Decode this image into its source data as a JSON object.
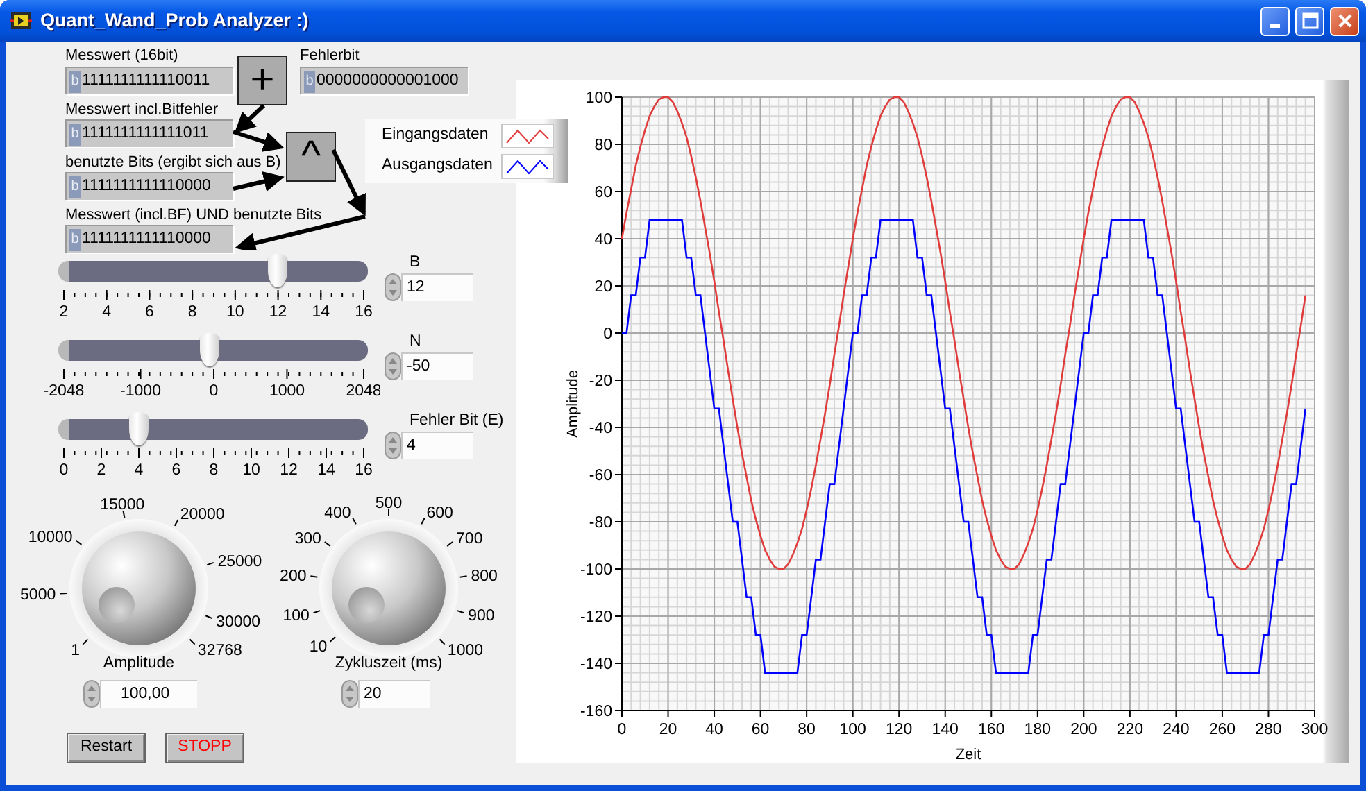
{
  "window": {
    "title": "Quant_Wand_Prob Analyzer :)"
  },
  "bit_indicators": [
    {
      "label": "Messwert (16bit)",
      "radix": "b",
      "value": "1111111111110011"
    },
    {
      "label": "Fehlerbit",
      "radix": "b",
      "value": "0000000000001000"
    },
    {
      "label": "Messwert incl.Bitfehler",
      "radix": "b",
      "value": "1111111111111011"
    },
    {
      "label": "benutzte Bits (ergibt sich aus B)",
      "radix": "b",
      "value": "1111111111110000"
    },
    {
      "label": "Messwert (incl.BF) UND benutzte Bits",
      "radix": "b",
      "value": "1111111111110000"
    }
  ],
  "operators": [
    "+",
    "^"
  ],
  "sliders": [
    {
      "label": "B",
      "level": 0.714,
      "ticks": [
        "2",
        "4",
        "6",
        "8",
        "10",
        "12",
        "14",
        "16"
      ],
      "value": "12"
    },
    {
      "label": "N",
      "level": 0.488,
      "ticks": [
        "-2048",
        "-1000",
        "0",
        "1000",
        "2048"
      ],
      "value": "-50"
    },
    {
      "label": "Fehler Bit (E)",
      "level": 0.25,
      "ticks": [
        "0",
        "2",
        "4",
        "6",
        "8",
        "10",
        "12",
        "14",
        "16"
      ],
      "value": "4"
    }
  ],
  "knobs": [
    {
      "label": "Amplitude",
      "ticks": [
        "1",
        "5000",
        "10000",
        "15000",
        "20000",
        "25000",
        "30000",
        "32768"
      ],
      "value": "100,00"
    },
    {
      "label": "Zykluszeit (ms)",
      "ticks": [
        "10",
        "100",
        "200",
        "300",
        "400",
        "500",
        "600",
        "700",
        "800",
        "900",
        "1000"
      ],
      "value": "20"
    }
  ],
  "buttons": [
    {
      "label": "Restart",
      "kind": "normal"
    },
    {
      "label": "STOPP",
      "kind": "stop"
    }
  ],
  "chart": {
    "chart_data": {
      "type": "line",
      "grid": true,
      "xlabel": "Zeit",
      "ylabel": "Amplitude",
      "xlim": [
        0,
        300
      ],
      "ylim": [
        -160,
        100
      ],
      "xticks": [
        0,
        20,
        40,
        60,
        80,
        100,
        120,
        140,
        160,
        180,
        200,
        220,
        240,
        260,
        280,
        300
      ],
      "yticks": [
        -160,
        -140,
        -120,
        -100,
        -80,
        -60,
        -40,
        -20,
        0,
        20,
        40,
        60,
        80,
        100
      ],
      "x": [
        0,
        2,
        4,
        6,
        8,
        10,
        12,
        14,
        16,
        18,
        20,
        22,
        24,
        26,
        28,
        30,
        32,
        34,
        36,
        38,
        40,
        42,
        44,
        46,
        48,
        50,
        52,
        54,
        56,
        58,
        60,
        62,
        64,
        66,
        68,
        70,
        72,
        74,
        76,
        78,
        80,
        82,
        84,
        86,
        88,
        90,
        92,
        94,
        96,
        98,
        100,
        102,
        104,
        106,
        108,
        110,
        112,
        114,
        116,
        118,
        120,
        122,
        124,
        126,
        128,
        130,
        132,
        134,
        136,
        138,
        140,
        142,
        144,
        146,
        148,
        150,
        152,
        154,
        156,
        158,
        160,
        162,
        164,
        166,
        168,
        170,
        172,
        174,
        176,
        178,
        180,
        182,
        184,
        186,
        188,
        190,
        192,
        194,
        196,
        198,
        200,
        202,
        204,
        206,
        208,
        210,
        212,
        214,
        216,
        218,
        220,
        222,
        224,
        226,
        228,
        230,
        232,
        234,
        236,
        238,
        240,
        242,
        244,
        246,
        248,
        250,
        252,
        254,
        256,
        258,
        260,
        262,
        264,
        266,
        268,
        270,
        272,
        274,
        276,
        278,
        280,
        282,
        284,
        286,
        288,
        290,
        292,
        294,
        296
      ],
      "series": [
        {
          "name": "Eingangsdaten",
          "color": "#e03c3c",
          "values": [
            40,
            51,
            61,
            71,
            79,
            86,
            92,
            96,
            99,
            100,
            100,
            98,
            94,
            89,
            83,
            75,
            66,
            56,
            45,
            34,
            22,
            9,
            -3,
            -16,
            -28,
            -40,
            -51,
            -61,
            -71,
            -79,
            -86,
            -92,
            -96,
            -99,
            -100,
            -100,
            -98,
            -94,
            -89,
            -83,
            -75,
            -66,
            -56,
            -45,
            -34,
            -22,
            -9,
            3,
            16,
            28,
            40,
            51,
            61,
            71,
            79,
            86,
            92,
            96,
            99,
            100,
            100,
            98,
            94,
            89,
            83,
            75,
            66,
            56,
            45,
            34,
            22,
            9,
            -3,
            -16,
            -28,
            -40,
            -51,
            -61,
            -71,
            -79,
            -86,
            -92,
            -96,
            -99,
            -100,
            -100,
            -98,
            -94,
            -89,
            -83,
            -75,
            -66,
            -56,
            -45,
            -34,
            -22,
            -9,
            3,
            16,
            28,
            40,
            51,
            61,
            71,
            79,
            86,
            92,
            96,
            99,
            100,
            100,
            98,
            94,
            89,
            83,
            75,
            66,
            56,
            45,
            34,
            22,
            9,
            -3,
            -16,
            -28,
            -40,
            -51,
            -61,
            -71,
            -79,
            -86,
            -92,
            -96,
            -99,
            -100,
            -100,
            -98,
            -94,
            -89,
            -83,
            -75,
            -66,
            -56,
            -45,
            -34,
            -22,
            -9,
            3,
            16
          ]
        },
        {
          "name": "Ausgangsdaten",
          "color": "#0000ff",
          "values": [
            0,
            0,
            16,
            16,
            32,
            32,
            48,
            48,
            48,
            48,
            48,
            48,
            48,
            48,
            32,
            32,
            16,
            16,
            0,
            -16,
            -32,
            -32,
            -48,
            -64,
            -80,
            -80,
            -96,
            -112,
            -112,
            -128,
            -128,
            -144,
            -144,
            -144,
            -144,
            -144,
            -144,
            -144,
            -144,
            -128,
            -128,
            -112,
            -96,
            -96,
            -80,
            -64,
            -64,
            -48,
            -32,
            -16,
            0,
            0,
            16,
            16,
            32,
            32,
            48,
            48,
            48,
            48,
            48,
            48,
            48,
            48,
            32,
            32,
            16,
            16,
            0,
            -16,
            -32,
            -32,
            -48,
            -64,
            -80,
            -80,
            -96,
            -112,
            -112,
            -128,
            -128,
            -144,
            -144,
            -144,
            -144,
            -144,
            -144,
            -144,
            -144,
            -128,
            -128,
            -112,
            -96,
            -96,
            -80,
            -64,
            -64,
            -48,
            -32,
            -16,
            0,
            0,
            16,
            16,
            32,
            32,
            48,
            48,
            48,
            48,
            48,
            48,
            48,
            48,
            32,
            32,
            16,
            16,
            0,
            -16,
            -32,
            -32,
            -48,
            -64,
            -80,
            -80,
            -96,
            -112,
            -112,
            -128,
            -128,
            -144,
            -144,
            -144,
            -144,
            -144,
            -144,
            -144,
            -144,
            -128,
            -128,
            -112,
            -96,
            -96,
            -80,
            -64,
            -64,
            -48,
            -32
          ]
        }
      ]
    }
  }
}
